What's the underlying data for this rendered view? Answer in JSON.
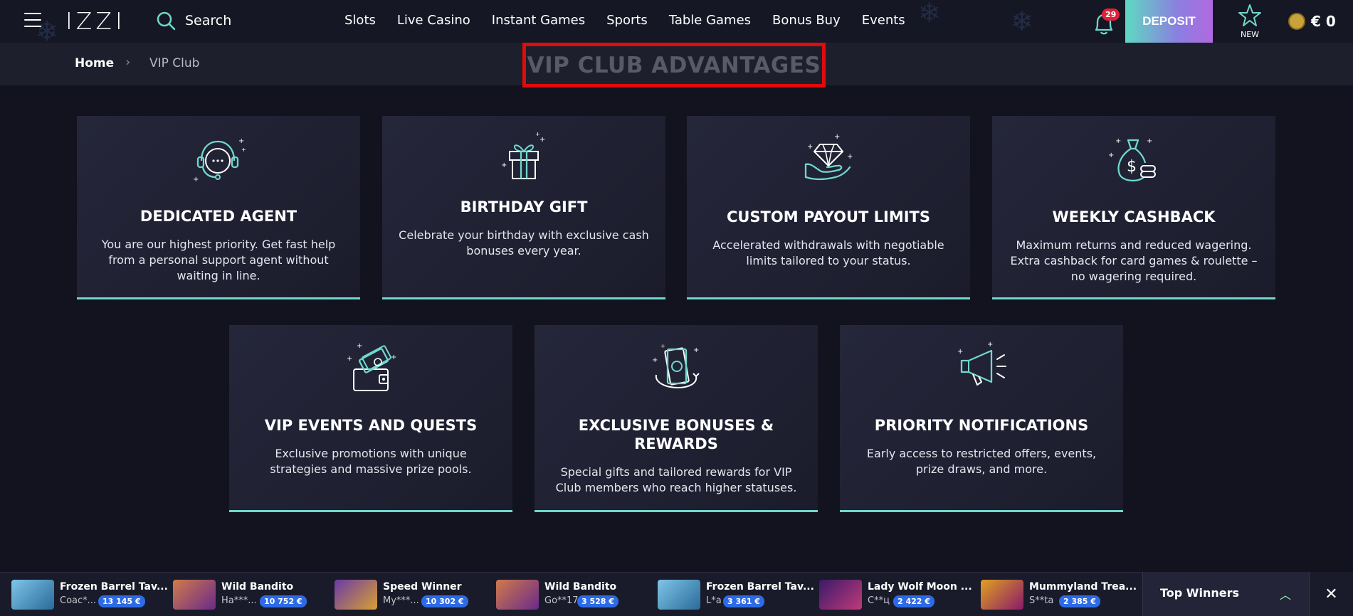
{
  "header": {
    "logo": "IZZI",
    "search_label": "Search",
    "nav": [
      "Slots",
      "Live Casino",
      "Instant Games",
      "Sports",
      "Table Games",
      "Bonus Buy",
      "Events"
    ],
    "notifications_count": "29",
    "deposit_label": "DEPOSIT",
    "new_label": "NEW",
    "balance": "€ 0"
  },
  "breadcrumb": {
    "home": "Home",
    "separator": "›",
    "current": "VIP Club"
  },
  "page_title": "VIP CLUB ADVANTAGES",
  "cards": [
    {
      "title": "DEDICATED AGENT",
      "desc": "You are our highest priority. Get fast help from a personal support agent without waiting in line.",
      "icon": "headset-icon"
    },
    {
      "title": "BIRTHDAY GIFT",
      "desc": "Celebrate your birthday with exclusive cash bonuses every year.",
      "icon": "gift-icon"
    },
    {
      "title": "CUSTOM PAYOUT LIMITS",
      "desc": "Accelerated withdrawals with negotiable limits tailored to your status.",
      "icon": "diamond-hand-icon"
    },
    {
      "title": "WEEKLY CASHBACK",
      "desc": "Maximum returns and reduced wagering. Extra cashback for card games & roulette – no wagering required.",
      "icon": "money-bag-icon"
    },
    {
      "title": "VIP EVENTS AND QUESTS",
      "desc": "Exclusive promotions with unique strategies and massive prize pools.",
      "icon": "wallet-icon"
    },
    {
      "title": "EXCLUSIVE BONUSES & REWARDS",
      "desc": "Special gifts and tailored rewards for VIP Club members who reach higher statuses.",
      "icon": "cash-stack-icon"
    },
    {
      "title": "PRIORITY NOTIFICATIONS",
      "desc": "Early access to restricted offers, events, prize draws, and more.",
      "icon": "megaphone-icon"
    }
  ],
  "ticker": [
    {
      "game": "Frozen Barrel Tav...",
      "user": "Coac*...",
      "amount": "13 145 €"
    },
    {
      "game": "Wild Bandito",
      "user": "Ha***...",
      "amount": "10 752 €"
    },
    {
      "game": "Speed Winner",
      "user": "My***...",
      "amount": "10 302 €"
    },
    {
      "game": "Wild Bandito",
      "user": "Go**17",
      "amount": "3 528 €"
    },
    {
      "game": "Frozen Barrel Tav...",
      "user": "L*a",
      "amount": "3 361 €"
    },
    {
      "game": "Lady Wolf Moon ...",
      "user": "С**ц",
      "amount": "2 422 €"
    },
    {
      "game": "Mummyland Trea...",
      "user": "S**ta",
      "amount": "2 385 €"
    }
  ],
  "top_winners_label": "Top Winners",
  "colors": {
    "accent": "#6fd8cc",
    "background": "#12131f",
    "highlight_box": "#e00b0b",
    "deposit_gradient_start": "#5fd9c2",
    "deposit_gradient_end": "#b06ae0"
  }
}
